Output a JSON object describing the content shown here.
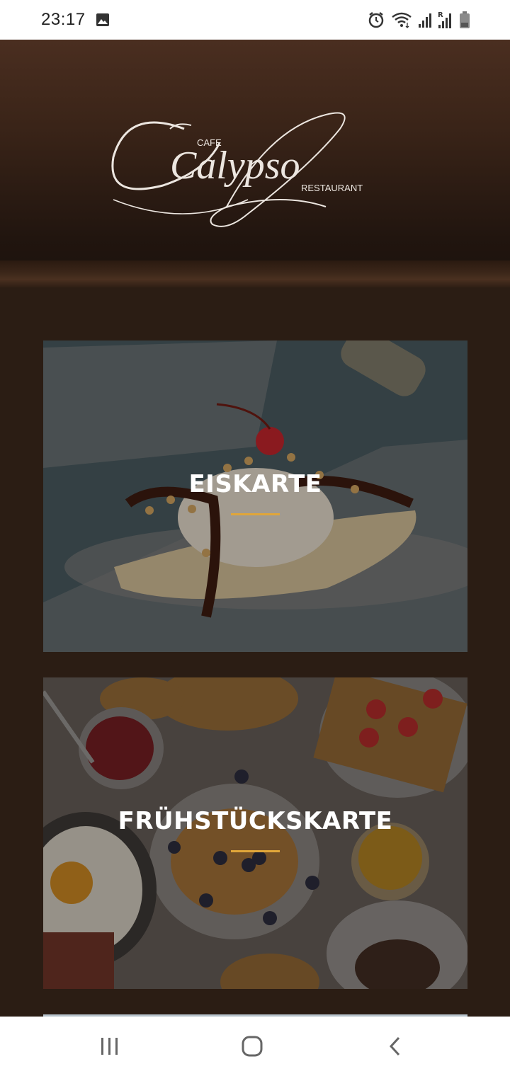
{
  "status_bar": {
    "time": "23:17",
    "icons": [
      "image-icon",
      "alarm-icon",
      "wifi-icon",
      "signal-icon",
      "signal-roaming-icon",
      "battery-icon"
    ]
  },
  "header": {
    "logo": {
      "cafe": "CAFE",
      "name": "Calypso",
      "restaurant": "RESTAURANT"
    }
  },
  "menu": {
    "cards": [
      {
        "title": "EISKARTE",
        "accent": "#e0a63a"
      },
      {
        "title": "FRÜHSTÜCKSKARTE",
        "accent": "#e0a63a"
      }
    ]
  },
  "nav_bar": {
    "icons": [
      "recent-apps-icon",
      "home-icon",
      "back-icon"
    ]
  },
  "colors": {
    "header_top": "#4a2e20",
    "content_bg": "#2b1d14",
    "accent": "#e0a63a"
  }
}
